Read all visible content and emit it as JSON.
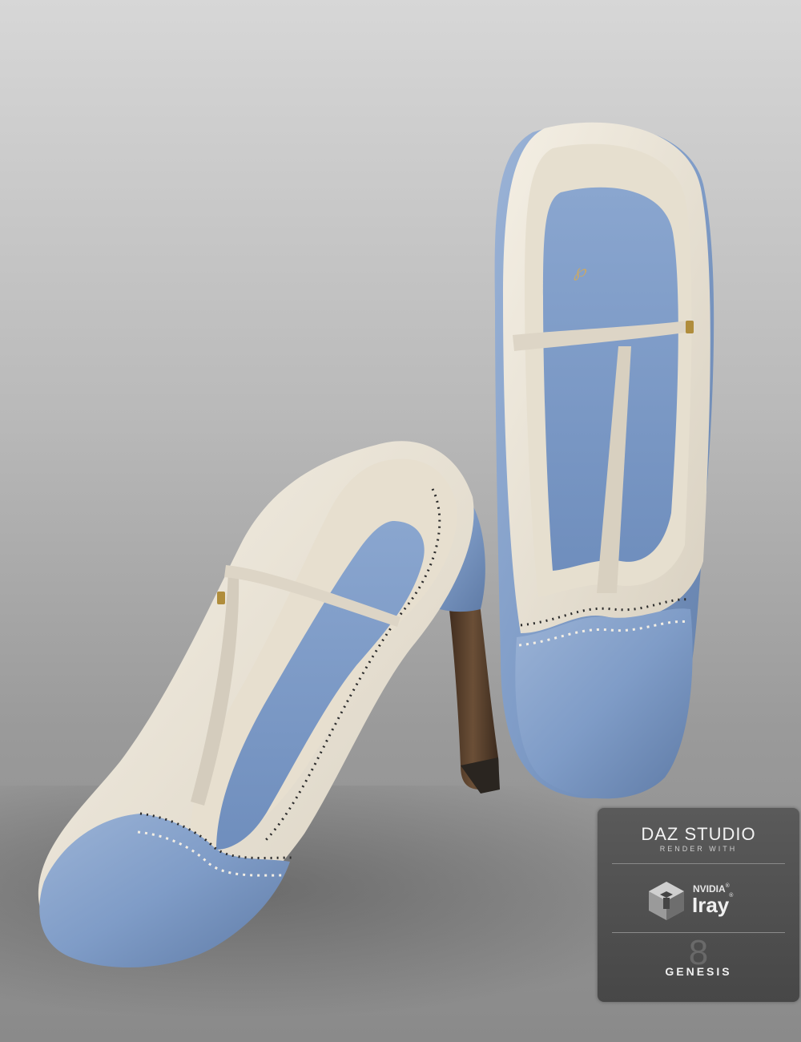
{
  "badge": {
    "daz_studio": "DAZ STUDIO",
    "render_with": "RENDER WITH",
    "nvidia": "NVIDIA",
    "iray": "Iray",
    "genesis": "GENESIS",
    "genesis_number": "8"
  },
  "colors": {
    "background_top": "#d7d7d7",
    "background_bottom": "#8a8a8a",
    "shoe_blue": "#7f9cc7",
    "shoe_cream": "#ece6d9",
    "heel_wood": "#5a4230",
    "badge_bg": "#4f4f4f"
  }
}
